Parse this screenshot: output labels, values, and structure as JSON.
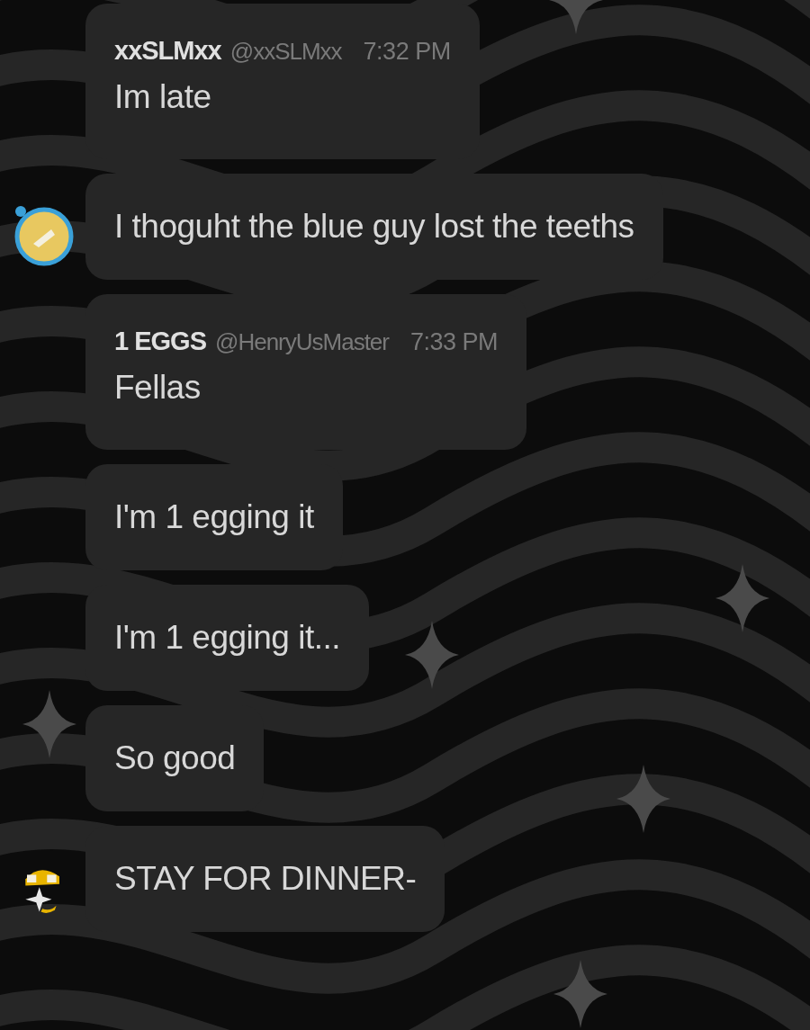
{
  "messages": [
    {
      "header": {
        "author": "xxSLMxx",
        "handle": "@xxSLMxx",
        "time": "7:32 PM"
      },
      "text": "Im late",
      "avatar": false
    },
    {
      "text": "I thoguht the blue guy lost the teeths",
      "avatar": true
    },
    {
      "header": {
        "author": "1 EGGS",
        "handle": "@HenryUsMaster",
        "time": "7:33 PM"
      },
      "text": "Fellas",
      "avatar": false
    },
    {
      "text": "I'm 1 egging it",
      "avatar": false
    },
    {
      "text": "I'm 1 egging it...",
      "avatar": false
    },
    {
      "text": "So good",
      "avatar": false
    },
    {
      "text": "STAY FOR DINNER-",
      "avatar": true
    }
  ]
}
